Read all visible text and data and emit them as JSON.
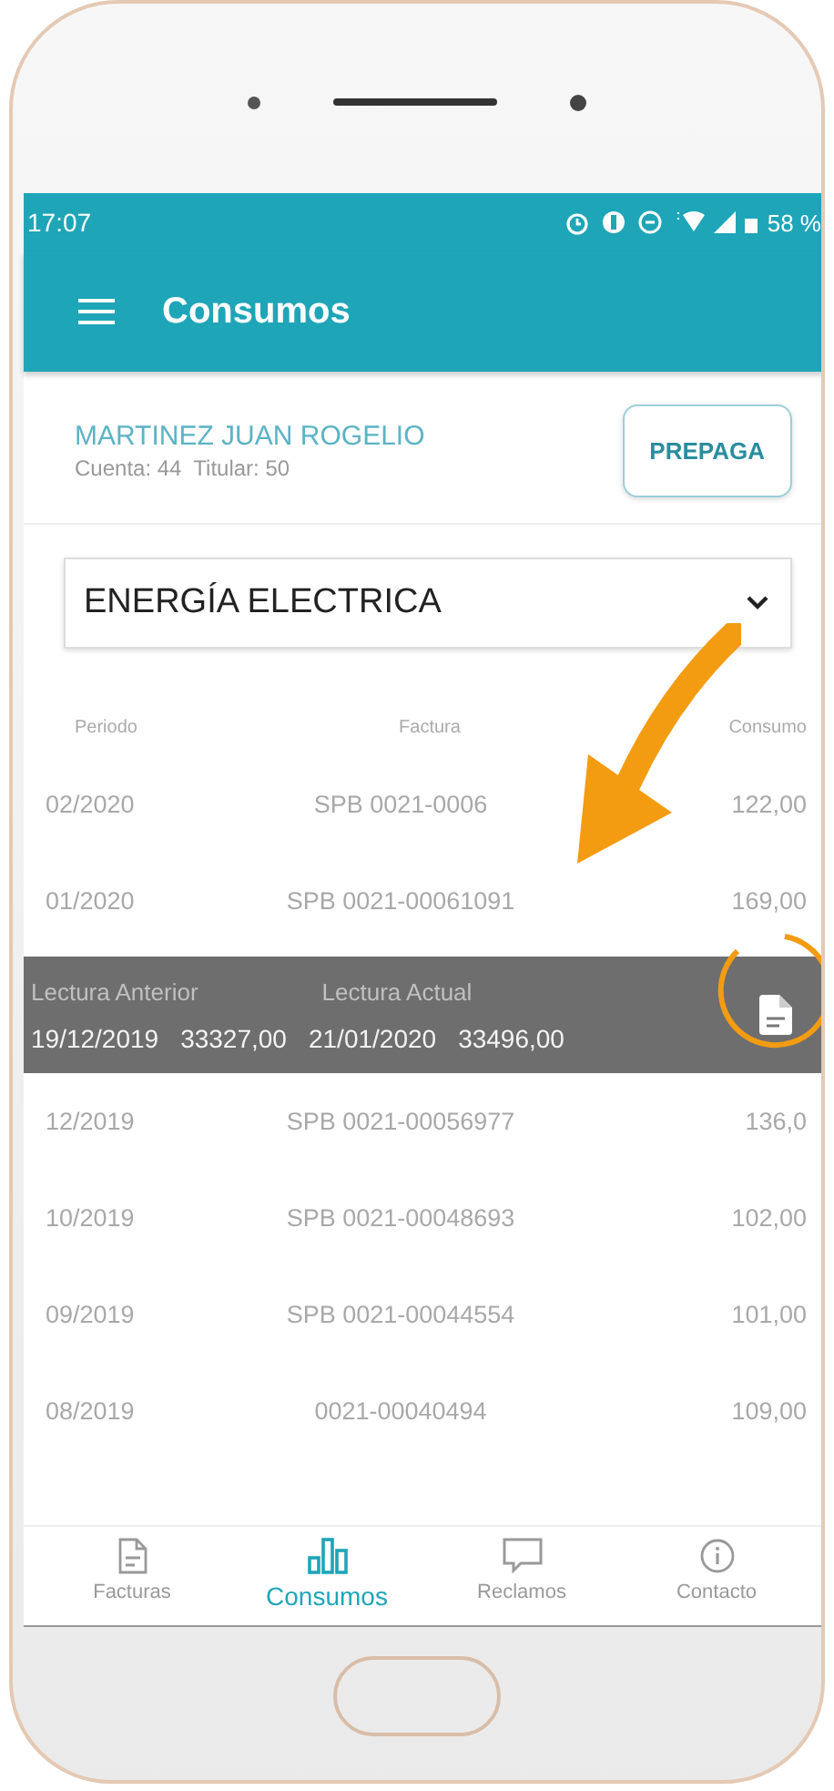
{
  "status_bar": {
    "time": "17:07",
    "battery": "58 %"
  },
  "app_bar": {
    "title": "Consumos"
  },
  "account": {
    "name": "MARTINEZ JUAN ROGELIO",
    "details": "Cuenta: 44  Titular: 50",
    "button": "PREPAGA"
  },
  "service_select": {
    "value": "ENERGÍA ELECTRICA"
  },
  "table": {
    "columns": [
      "Periodo",
      "Factura",
      "Consumo"
    ],
    "rows": [
      {
        "period": "02/2020",
        "invoice": "SPB 0021-0006",
        "consumption": "122,00"
      },
      {
        "period": "01/2020",
        "invoice": "SPB 0021-00061091",
        "consumption": "169,00",
        "detail": {
          "labels": [
            "Lectura Anterior",
            "Lectura Actual"
          ],
          "values": [
            "19/12/2019",
            "33327,00",
            "21/01/2020",
            "33496,00"
          ]
        }
      },
      {
        "period": "12/2019",
        "invoice": "SPB 0021-00056977",
        "consumption": "136,0"
      },
      {
        "period": "10/2019",
        "invoice": "SPB 0021-00048693",
        "consumption": "102,00"
      },
      {
        "period": "09/2019",
        "invoice": "SPB 0021-00044554",
        "consumption": "101,00"
      },
      {
        "period": "08/2019",
        "invoice": "0021-00040494",
        "consumption": "109,00"
      }
    ]
  },
  "bottom_nav": [
    {
      "label": "Facturas",
      "kind": "document",
      "selected": false
    },
    {
      "label": "Consumos",
      "kind": "chart",
      "selected": true
    },
    {
      "label": "Reclamos",
      "kind": "chat",
      "selected": false
    },
    {
      "label": "Contacto",
      "kind": "info",
      "selected": false
    }
  ]
}
